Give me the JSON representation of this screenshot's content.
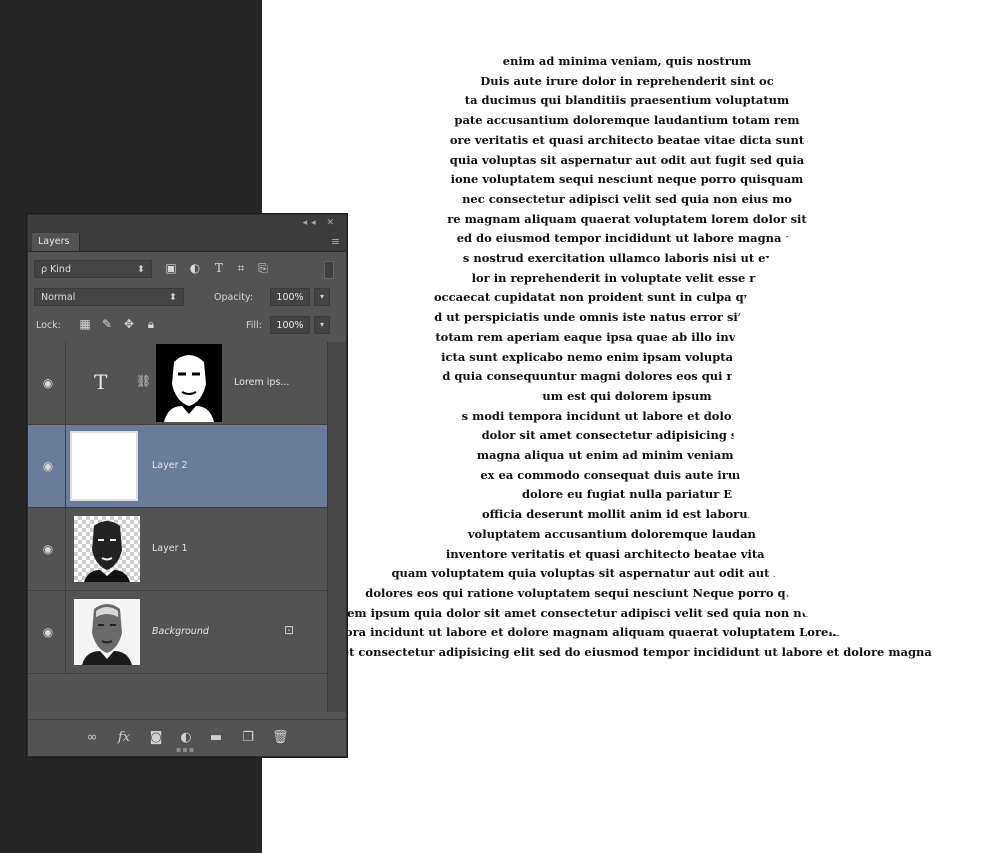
{
  "doc": {
    "lines": [
      "enim ad minima veniam, quis nostrum",
      "Duis aute irure dolor in reprehenderit sint oc",
      "ta ducimus qui blanditiis praesentium voluptatum",
      "pate accusantium doloremque laudantium totam rem",
      "ore veritatis et quasi architecto beatae vitae dicta sunt",
      "quia voluptas sit aspernatur aut odit aut fugit sed quia",
      "ione voluptatem sequi nesciunt neque porro quisquam",
      "nec consectetur adipisci velit sed quia non eius mo",
      "re magnam aliquam quaerat voluptatem lorem dolor sit",
      "ed do eiusmod tempor incididunt ut labore magna al",
      "s nostrud exercitation ullamco laboris nisi ut ex ea",
      "lor in reprehenderit in voluptate velit esse re eu",
      "occaecat cupidatat non proident sunt in culpa qui officia de",
      "d ut perspiciatis unde omnis iste natus error sit voluptatem",
      "totam rem aperiam eaque ipsa quae ab illo inventore verita",
      "icta sunt explicabo nemo enim ipsam voluptatem quia vol",
      "d quia consequuntur magni dolores eos qui ratione sequi",
      "um est qui dolorem ipsum",
      "s modi tempora incidunt ut labore et dolore magna",
      "dolor sit amet consectetur adipisicing sed do",
      "magna aliqua ut enim ad minim veniam quis n",
      "ex ea commodo consequat duis aute irure dol",
      "dolore eu fugiat nulla pariatur E",
      "officia deserunt mollit anim id est laborum S",
      "voluptatem accusantium doloremque laudantium",
      "inventore veritatis et quasi architecto beatae vitae dicta",
      "quam voluptatem quia voluptas sit aspernatur aut odit aut fugit sed quia",
      "dolores eos qui ratione voluptatem sequi nesciunt Neque porro quisquam est qui",
      "lorem ipsum quia dolor sit amet consectetur adipisci velit sed quia non numquam eius modi",
      "tempora incidunt ut labore et dolore magnam aliquam quaerat voluptatem Lorem ipsum dolor sit",
      "amet consectetur adipisicing elit sed do eiusmod tempor incididunt ut labore et dolore magna"
    ]
  },
  "panel": {
    "tab_label": "Layers",
    "kind_label": "ρ Kind",
    "blend_mode": "Normal",
    "opacity_label": "Opacity:",
    "opacity_value": "100%",
    "lock_label": "Lock:",
    "fill_label": "Fill:",
    "fill_value": "100%",
    "layers": [
      {
        "name": "Lorem ips...",
        "type": "text"
      },
      {
        "name": "Layer 2",
        "type": "pixel"
      },
      {
        "name": "Layer 1",
        "type": "pixel"
      },
      {
        "name": "Background",
        "type": "background"
      }
    ]
  },
  "icons": {
    "visibility": "eye-icon",
    "lock": "lock-icon"
  }
}
